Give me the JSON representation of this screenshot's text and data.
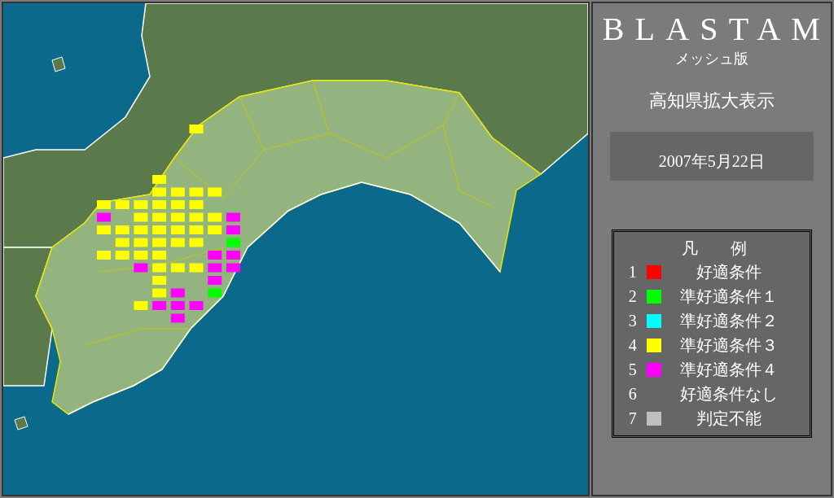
{
  "panel": {
    "title": "BLASTAM",
    "subtitle": "メッシュ版",
    "region": "高知県拡大表示",
    "date": "2007年5月22日"
  },
  "legend": {
    "title": "凡　　例",
    "items": [
      {
        "number": "1",
        "label": "好適条件",
        "color": "#ff0000"
      },
      {
        "number": "2",
        "label": "準好適条件１",
        "color": "#00ff00"
      },
      {
        "number": "3",
        "label": "準好適条件２",
        "color": "#00ffff"
      },
      {
        "number": "4",
        "label": "準好適条件３",
        "color": "#ffff00"
      },
      {
        "number": "5",
        "label": "準好適条件４",
        "color": "#ff00ff"
      },
      {
        "number": "6",
        "label": "好適条件なし"
      },
      {
        "number": "7",
        "label": "判定不能",
        "color": "#c0c0c0"
      }
    ]
  }
}
